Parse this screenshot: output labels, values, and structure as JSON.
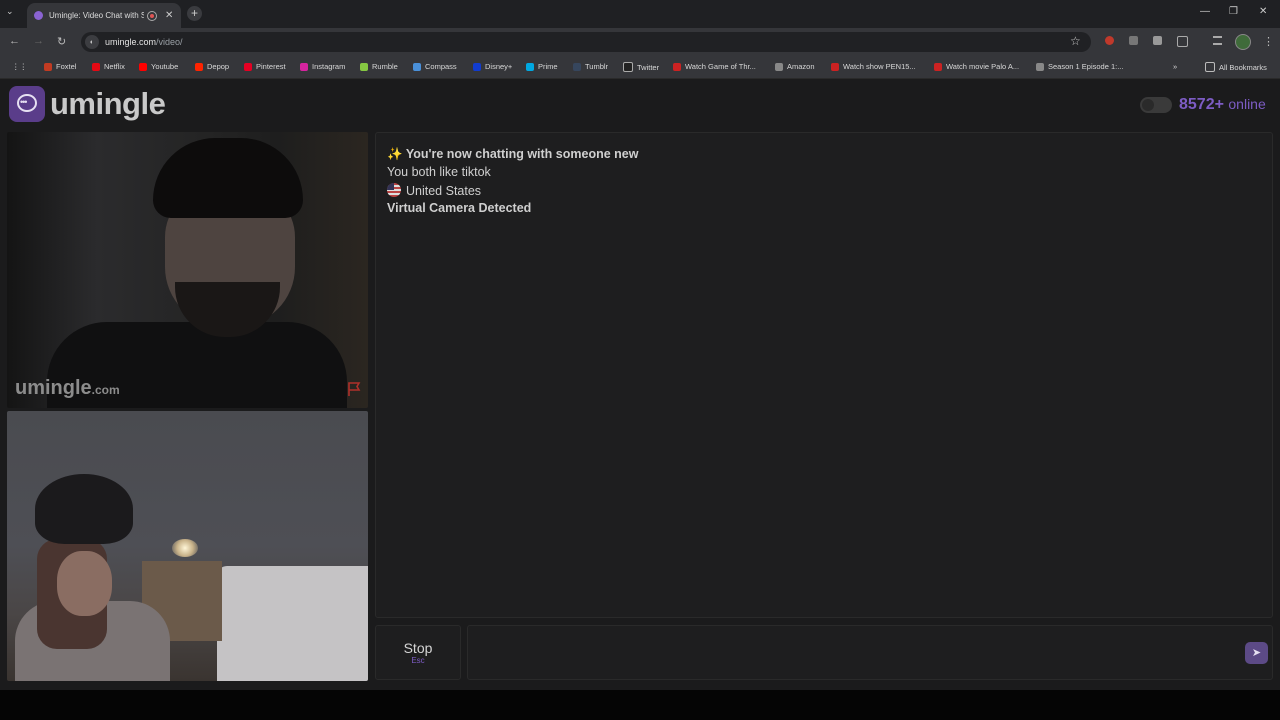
{
  "browser": {
    "tab_title": "Umingle: Video Chat with S",
    "tab_close": "✕",
    "new_tab": "+",
    "tab_list": "⌄",
    "window_controls": {
      "minimize": "—",
      "maximize": "❐",
      "close": "✕"
    },
    "nav": {
      "back": "←",
      "forward": "→",
      "reload": "↻"
    },
    "url_host": "umingle.com",
    "url_path": "/video/",
    "star": "☆",
    "menu": "⋮",
    "bookmarks": [
      {
        "label": "Foxtel",
        "color": "#c23b22"
      },
      {
        "label": "Netflix",
        "color": "#e50914"
      },
      {
        "label": "Youtube",
        "color": "#ff0000"
      },
      {
        "label": "Depop",
        "color": "#ff2300"
      },
      {
        "label": "Pinterest",
        "color": "#e60023"
      },
      {
        "label": "Instagram",
        "color": "#d6249f"
      },
      {
        "label": "Rumble",
        "color": "#85c742"
      },
      {
        "label": "Compass",
        "color": "#4a90d9"
      },
      {
        "label": "Disney+",
        "color": "#113ccf"
      },
      {
        "label": "Prime",
        "color": "#00a8e1"
      },
      {
        "label": "Tumblr",
        "color": "#36465d"
      },
      {
        "label": "Twitter",
        "color": "#222222"
      },
      {
        "label": "Watch Game of Thr...",
        "color": "#cc2222"
      },
      {
        "label": "Amazon",
        "color": "#888888"
      },
      {
        "label": "Watch show PEN15...",
        "color": "#cc2222"
      },
      {
        "label": "Watch movie Palo A...",
        "color": "#cc2222"
      },
      {
        "label": "Season 1 Episode 1:...",
        "color": "#888888"
      }
    ],
    "more_bookmarks": "»",
    "all_bookmarks": "All Bookmarks"
  },
  "site": {
    "logo_text": "umingle",
    "online_count": "8572+",
    "online_label": "online",
    "accent": "#7d5cc4"
  },
  "video": {
    "watermark": "umingle",
    "watermark_suffix": ".com"
  },
  "chat": {
    "messages": [
      {
        "icon": "✨",
        "text": "You're now chatting with someone new",
        "bold": true
      },
      {
        "text": "You both like tiktok",
        "bold": false
      },
      {
        "text": "United States",
        "bold": false
      },
      {
        "text": "Virtual Camera Detected",
        "bold": true
      }
    ]
  },
  "controls": {
    "stop_label": "Stop",
    "stop_key": "Esc",
    "send_icon": "➤"
  }
}
